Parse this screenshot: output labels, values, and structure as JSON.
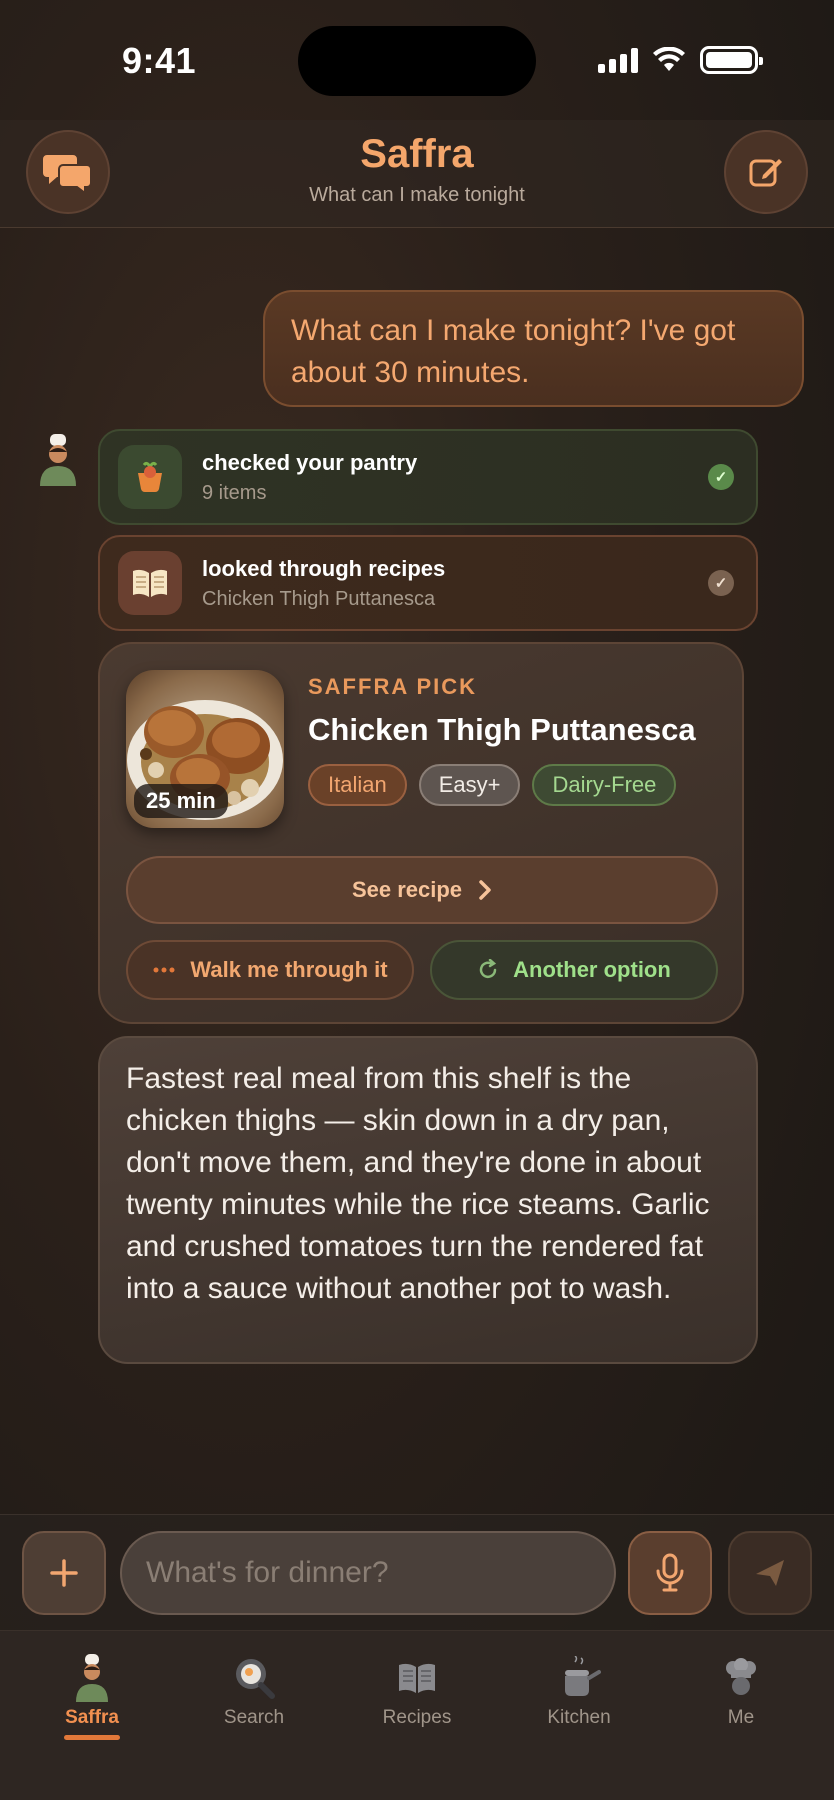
{
  "status_bar": {
    "time": "9:41"
  },
  "header": {
    "title": "Saffra",
    "subtitle": "What can I make tonight"
  },
  "user_message": "What can I make tonight? I've got about 30 minutes.",
  "tool_steps": [
    {
      "title": "checked your pantry",
      "detail": "9 items",
      "icon": "pantry-basket-icon"
    },
    {
      "title": "looked through recipes",
      "detail": "Chicken Thigh Puttanesca",
      "icon": "open-book-icon"
    }
  ],
  "pick": {
    "eyebrow": "SAFFRA PICK",
    "title": "Chicken Thigh Puttanesca",
    "time_badge": "25 min",
    "tags": [
      "Italian",
      "Easy+",
      "Dairy-Free"
    ],
    "see_recipe_label": "See recipe",
    "walk_label": "Walk me through it",
    "another_label": "Another option"
  },
  "assistant_message": "Fastest real meal from this shelf is the chicken thighs — skin down in a dry pan, don't move them, and they're done in about twenty minutes while the rice steams. Garlic and crushed tomatoes turn the rendered fat into a sauce without another pot to wash.",
  "composer": {
    "placeholder": "What's for dinner?"
  },
  "tabs": [
    {
      "label": "Saffra",
      "icon": "chef-avatar-icon",
      "active": true
    },
    {
      "label": "Search",
      "icon": "search-pan-icon",
      "active": false
    },
    {
      "label": "Recipes",
      "icon": "book-icon",
      "active": false
    },
    {
      "label": "Kitchen",
      "icon": "pot-icon",
      "active": false
    },
    {
      "label": "Me",
      "icon": "chef-hat-icon",
      "active": false
    }
  ],
  "colors": {
    "accent": "#f4a66b",
    "success": "#9fe08a",
    "background": "#2a201a"
  }
}
